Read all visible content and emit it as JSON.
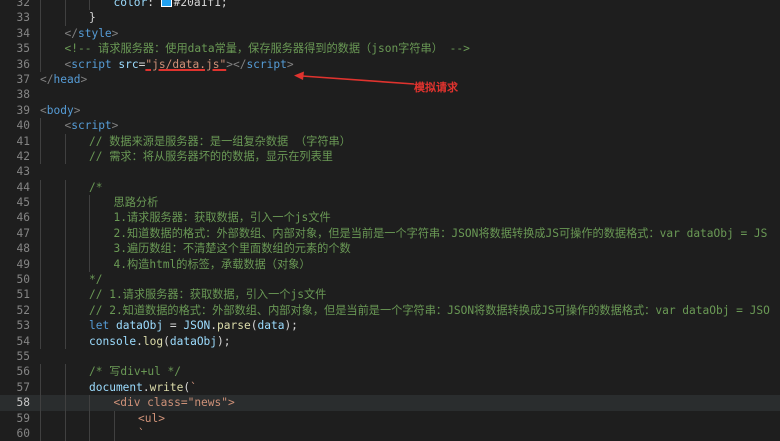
{
  "editor": {
    "lines": [
      {
        "n": "32",
        "indent": 3,
        "tokens": [
          {
            "c": "t-prop",
            "t": "color"
          },
          {
            "c": "t-plain",
            "t": ": "
          },
          {
            "c": "swatch",
            "t": ""
          },
          {
            "c": "t-plain",
            "t": "#20a1f1;"
          }
        ]
      },
      {
        "n": "33",
        "indent": 2,
        "tokens": [
          {
            "c": "t-plain",
            "t": "}"
          }
        ]
      },
      {
        "n": "34",
        "indent": 1,
        "tokens": [
          {
            "c": "t-punc",
            "t": "</"
          },
          {
            "c": "t-tag",
            "t": "style"
          },
          {
            "c": "t-punc",
            "t": ">"
          }
        ]
      },
      {
        "n": "35",
        "indent": 1,
        "tokens": [
          {
            "c": "t-cmt",
            "t": "<!-- 请求服务器：使用data常量，保存服务器得到的数据（json字符串） -->"
          }
        ]
      },
      {
        "n": "36",
        "indent": 1,
        "tokens": [
          {
            "c": "t-punc",
            "t": "<"
          },
          {
            "c": "t-tag",
            "t": "script"
          },
          {
            "c": "t-plain",
            "t": " "
          },
          {
            "c": "t-attr",
            "t": "src"
          },
          {
            "c": "t-plain",
            "t": "="
          },
          {
            "c": "t-str underline-red",
            "t": "\"js/data.js\""
          },
          {
            "c": "t-punc",
            "t": "></"
          },
          {
            "c": "t-tag",
            "t": "script"
          },
          {
            "c": "t-punc",
            "t": ">"
          }
        ]
      },
      {
        "n": "37",
        "indent": 0,
        "tokens": [
          {
            "c": "t-punc",
            "t": "</"
          },
          {
            "c": "t-tag",
            "t": "head"
          },
          {
            "c": "t-punc",
            "t": ">"
          }
        ]
      },
      {
        "n": "38",
        "indent": 0,
        "tokens": []
      },
      {
        "n": "39",
        "indent": 0,
        "tokens": [
          {
            "c": "t-punc",
            "t": "<"
          },
          {
            "c": "t-tag",
            "t": "body"
          },
          {
            "c": "t-punc",
            "t": ">"
          }
        ]
      },
      {
        "n": "40",
        "indent": 1,
        "tokens": [
          {
            "c": "t-punc",
            "t": "<"
          },
          {
            "c": "t-tag",
            "t": "script"
          },
          {
            "c": "t-punc",
            "t": ">"
          }
        ]
      },
      {
        "n": "41",
        "indent": 2,
        "tokens": [
          {
            "c": "t-cmt",
            "t": "// 数据来源是服务器：是一组复杂数据 （字符串）"
          }
        ]
      },
      {
        "n": "42",
        "indent": 2,
        "tokens": [
          {
            "c": "t-cmt",
            "t": "// 需求：将从服务器坏的的数据，显示在列表里"
          }
        ]
      },
      {
        "n": "43",
        "indent": 0,
        "tokens": []
      },
      {
        "n": "44",
        "indent": 2,
        "tokens": [
          {
            "c": "t-cmt",
            "t": "/*"
          }
        ]
      },
      {
        "n": "45",
        "indent": 3,
        "tokens": [
          {
            "c": "t-cmt",
            "t": "思路分析"
          }
        ]
      },
      {
        "n": "46",
        "indent": 3,
        "tokens": [
          {
            "c": "t-cmt",
            "t": "1.请求服务器：获取数据，引入一个js文件"
          }
        ]
      },
      {
        "n": "47",
        "indent": 3,
        "tokens": [
          {
            "c": "t-cmt",
            "t": "2.知道数据的格式：外部数组、内部对象，但是当前是一个字符串：JSON将数据转换成JS可操作的数据格式：var dataObj = JS"
          }
        ]
      },
      {
        "n": "48",
        "indent": 3,
        "tokens": [
          {
            "c": "t-cmt",
            "t": "3.遍历数组：不清楚这个里面数组的元素的个数"
          }
        ]
      },
      {
        "n": "49",
        "indent": 3,
        "tokens": [
          {
            "c": "t-cmt",
            "t": "4.构造html的标签，承载数据（对象）"
          }
        ]
      },
      {
        "n": "50",
        "indent": 2,
        "tokens": [
          {
            "c": "t-cmt",
            "t": "*/"
          }
        ]
      },
      {
        "n": "51",
        "indent": 2,
        "tokens": [
          {
            "c": "t-cmt",
            "t": "// 1.请求服务器：获取数据，引入一个js文件"
          }
        ]
      },
      {
        "n": "52",
        "indent": 2,
        "tokens": [
          {
            "c": "t-cmt",
            "t": "// 2.知道数据的格式：外部数组、内部对象，但是当前是一个字符串：JSON将数据转换成JS可操作的数据格式：var dataObj = JSO"
          }
        ]
      },
      {
        "n": "53",
        "indent": 2,
        "tokens": [
          {
            "c": "t-kw",
            "t": "let"
          },
          {
            "c": "t-plain",
            "t": " "
          },
          {
            "c": "t-var",
            "t": "dataObj"
          },
          {
            "c": "t-plain",
            "t": " = "
          },
          {
            "c": "t-var",
            "t": "JSON"
          },
          {
            "c": "t-plain",
            "t": "."
          },
          {
            "c": "t-fn",
            "t": "parse"
          },
          {
            "c": "t-plain",
            "t": "("
          },
          {
            "c": "t-var",
            "t": "data"
          },
          {
            "c": "t-plain",
            "t": ");"
          }
        ]
      },
      {
        "n": "54",
        "indent": 2,
        "tokens": [
          {
            "c": "t-var",
            "t": "console"
          },
          {
            "c": "t-plain",
            "t": "."
          },
          {
            "c": "t-fn",
            "t": "log"
          },
          {
            "c": "t-plain",
            "t": "("
          },
          {
            "c": "t-var",
            "t": "dataObj"
          },
          {
            "c": "t-plain",
            "t": ");"
          }
        ]
      },
      {
        "n": "55",
        "indent": 0,
        "tokens": []
      },
      {
        "n": "56",
        "indent": 2,
        "tokens": [
          {
            "c": "t-cmt",
            "t": "/* 写div+ul */"
          }
        ]
      },
      {
        "n": "57",
        "indent": 2,
        "tokens": [
          {
            "c": "t-var",
            "t": "document"
          },
          {
            "c": "t-plain",
            "t": "."
          },
          {
            "c": "t-fn",
            "t": "write"
          },
          {
            "c": "t-plain",
            "t": "("
          },
          {
            "c": "t-str",
            "t": "`"
          }
        ]
      },
      {
        "n": "58",
        "indent": 3,
        "active": true,
        "tokens": [
          {
            "c": "t-str",
            "t": "<div class=\"news\">"
          }
        ]
      },
      {
        "n": "59",
        "indent": 4,
        "tokens": [
          {
            "c": "t-str",
            "t": "<ul>"
          }
        ]
      },
      {
        "n": "60",
        "indent": 4,
        "tokens": [
          {
            "c": "t-str",
            "t": "`"
          }
        ]
      }
    ]
  },
  "annotation": {
    "label": "模拟请求",
    "color": "#e0332e"
  }
}
